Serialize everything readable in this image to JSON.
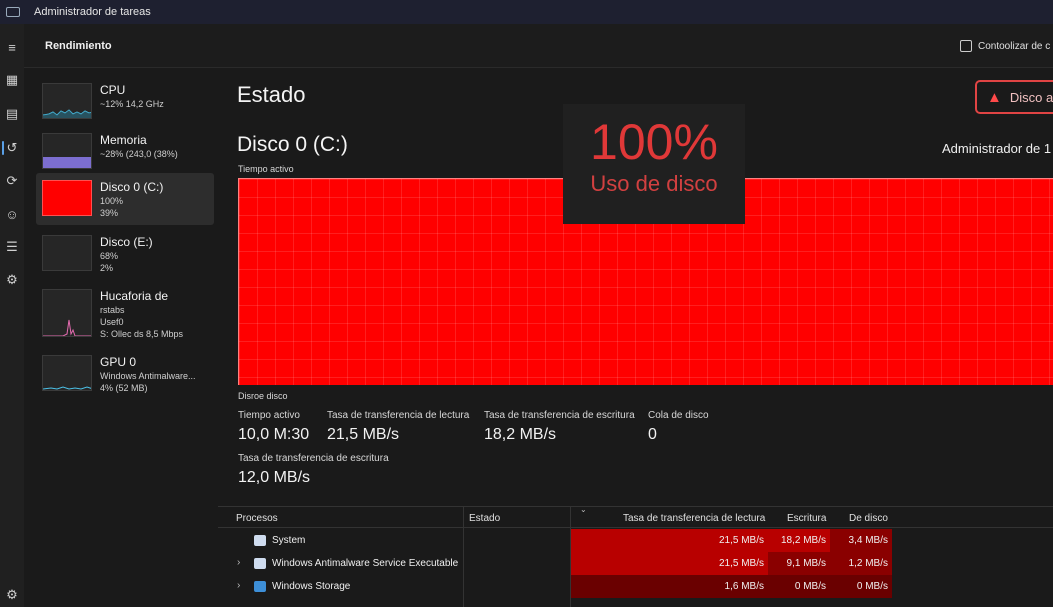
{
  "window": {
    "title": "Administrador de tareas"
  },
  "header": {
    "title": "Rendimiento",
    "customize": "Contoolizar de c"
  },
  "rail": {
    "items": [
      {
        "name": "hamburger-menu-icon",
        "glyph": "≡"
      },
      {
        "name": "processes-icon",
        "glyph": "▦"
      },
      {
        "name": "performance-icon",
        "glyph": "▤"
      },
      {
        "name": "app-history-icon",
        "glyph": "↺"
      },
      {
        "name": "startup-apps-icon",
        "glyph": "⟳"
      },
      {
        "name": "users-icon",
        "glyph": "☺"
      },
      {
        "name": "details-icon",
        "glyph": "☰"
      },
      {
        "name": "services-icon",
        "glyph": "⚙"
      },
      {
        "name": "settings-icon",
        "glyph": "⚙"
      }
    ]
  },
  "devices": [
    {
      "name": "CPU",
      "l1": "~12% 14,2 GHz",
      "l2": "",
      "l3": ""
    },
    {
      "name": "Memoria",
      "l1": "~28% (243,0 (38%)",
      "l2": "",
      "l3": ""
    },
    {
      "name": "Disco 0 (C:)",
      "l1": "100%",
      "l2": "39%",
      "l3": ""
    },
    {
      "name": "Disco (E:)",
      "l1": "68%",
      "l2": "2%",
      "l3": ""
    },
    {
      "name": "Hucaforia de",
      "l1": "rstabs",
      "l2": "Usef0",
      "l3": "S: Ollec ds 8,5 Mbps"
    },
    {
      "name": "GPU 0",
      "l1": "Windows Antimalware...",
      "l2": "4% (52 MB)",
      "l3": ""
    }
  ],
  "main": {
    "section": "Estado",
    "alert": "Disco a",
    "disk_title": "Disco 0 (C:)",
    "admin": "Administrador de 1",
    "graph_label": "Tiempo activo",
    "graph_bottom": "Disroe disco",
    "overlay_value": "100%",
    "overlay_label": "Uso de disco",
    "active_percent": 100
  },
  "stats": [
    {
      "label": "Tiempo activo",
      "value": "10,0 M:30"
    },
    {
      "label": "Tasa de transferencia de lectura",
      "value": "21,5 MB/s"
    },
    {
      "label": "Tasa de transferencia de escritura",
      "value": "18,2 MB/s"
    },
    {
      "label": "Cola de disco",
      "value": "0"
    },
    {
      "label": "Tasa de transferencia de escritura",
      "value": "12,0 MB/s"
    }
  ],
  "processes": {
    "headers": {
      "name": "Procesos",
      "status": "Estado",
      "read": "Tasa de transferencia de lectura",
      "write": "Escritura",
      "disk": "De disco"
    },
    "rows": [
      {
        "name": "System",
        "read": "21,5 MB/s",
        "write": "18,2 MB/s",
        "disk": "3,4 MB/s"
      },
      {
        "name": "Windows Antimalware Service Executable",
        "read": "21,5 MB/s",
        "write": "9,1 MB/s",
        "disk": "1,2 MB/s"
      },
      {
        "name": "Windows Storage",
        "read": "1,6 MB/s",
        "write": "0 MB/s",
        "disk": "0 MB/s"
      }
    ]
  },
  "colors": {
    "accent_red": "#ff0000",
    "heat_high": "#b80000",
    "heat_mid": "#8a0000",
    "heat_low": "#6a0000"
  }
}
